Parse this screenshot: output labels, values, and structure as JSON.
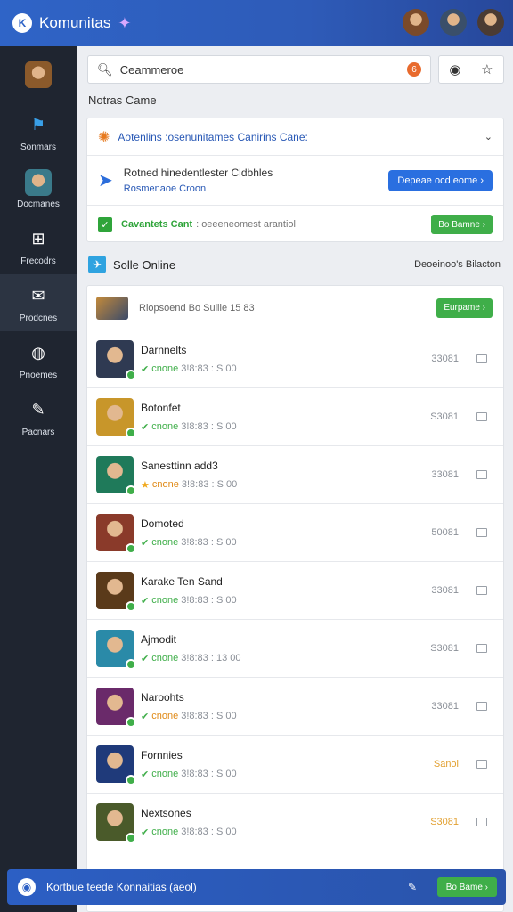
{
  "header": {
    "brand_logo_glyph": "K",
    "brand_name": "Komunitas",
    "avatars": [
      {
        "icon": "avatar",
        "color": "#7a4a2a"
      },
      {
        "icon": "avatar",
        "color": "#3a4f6a"
      },
      {
        "icon": "avatar",
        "color": "#4b3b33"
      }
    ]
  },
  "sidebar": {
    "items": [
      {
        "label": "",
        "icon": "avatar",
        "color": "#8b5a2b"
      },
      {
        "label": "Sonmars",
        "icon": "flag-icon"
      },
      {
        "label": "Docmanes",
        "icon": "avatar",
        "color": "#3a7a8a"
      },
      {
        "label": "Frecodrs",
        "icon": "gamepad-icon"
      },
      {
        "label": "Prodcnes",
        "icon": "inbox-icon"
      },
      {
        "label": "Pnoemes",
        "icon": "user-icon"
      },
      {
        "label": "Pacnars",
        "icon": "tool-icon"
      }
    ]
  },
  "search": {
    "value": "Ceammeroe",
    "notif_glyph": "6"
  },
  "section_title": "Notras Came",
  "notices": {
    "row1": {
      "text": "Aotenlins :osenunitames Canirins Cane:"
    },
    "row2": {
      "title": "Rotned hinedentlester Cldbhles",
      "subtitle": "Rosmenaoe Croon",
      "button": "Depeae ocd eome ›"
    },
    "row3": {
      "strong": "Cavantets Cant",
      "rest": ": oeeeneomest arantiol",
      "button": "Bo Bamne ›"
    }
  },
  "online": {
    "title": "Solle Online",
    "right_text": "Deoeinoo's Bilacton"
  },
  "list": {
    "top_text": "Rlopsoend Bo Sulile 15 83",
    "top_button": "Eurpame ›",
    "rows": [
      {
        "name": "Darnnelts",
        "meta_label": "cnone",
        "meta": "3!8:83 : S 00",
        "score": "33081",
        "color": "#2f3a52",
        "meta_kind": "normal"
      },
      {
        "name": "Botonfet",
        "meta_label": "cnone",
        "meta": "3!8:83 : S 00",
        "score": "S3081",
        "color": "#c8962a",
        "meta_kind": "normal"
      },
      {
        "name": "Sanesttinn add3",
        "meta_label": "cnone",
        "meta": "3!8:83 : S 00",
        "score": "33081",
        "color": "#1f7a5a",
        "meta_kind": "star"
      },
      {
        "name": "Domoted",
        "meta_label": "cnone",
        "meta": "3!8:83 : S 00",
        "score": "50081",
        "color": "#8a3a2a",
        "meta_kind": "normal"
      },
      {
        "name": "Karake Ten Sand",
        "meta_label": "cnone",
        "meta": "3!8:83 : S 00",
        "score": "33081",
        "color": "#5a3a1a",
        "meta_kind": "normal"
      },
      {
        "name": "Ajmodit",
        "meta_label": "cnone",
        "meta": "3!8:83 : 13 00",
        "score": "S3081",
        "color": "#2a8aa8",
        "meta_kind": "normal"
      },
      {
        "name": "Naroohts",
        "meta_label": "cnone",
        "meta": "3!8:83 : S 00",
        "score": "33081",
        "color": "#6a2a6a",
        "meta_kind": "orange"
      },
      {
        "name": "Fornnies",
        "meta_label": "cnone",
        "meta": "3!8:83 : S 00",
        "score": "Sanol",
        "color": "#1f3a7a",
        "meta_kind": "normal",
        "score_orange": true
      },
      {
        "name": "Nextsones",
        "meta_label": "cnone",
        "meta": "3!8:83 : S 00",
        "score": "S3081",
        "color": "#4a5a2a",
        "meta_kind": "normal",
        "score_orange": true
      }
    ]
  },
  "bottom_bar": {
    "text": "Kortbue teede Konnaitias (aeol)",
    "button": "Bo Bame ›"
  }
}
